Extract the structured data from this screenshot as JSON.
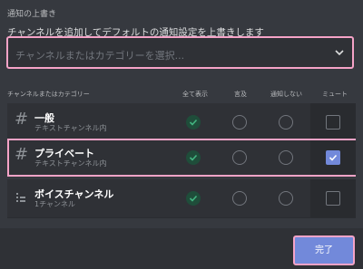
{
  "header": {
    "title": "通知の上書き",
    "description": "チャンネルを追加してデフォルトの通知設定を上書きします"
  },
  "select": {
    "placeholder": "チャンネルまたはカテゴリーを選択..."
  },
  "columns": {
    "channel": "チャンネルまたはカテゴリー",
    "all": "全て表示",
    "mentions": "言及",
    "nothing": "通知しない",
    "mute": "ミュート"
  },
  "rows": [
    {
      "name": "一般",
      "sub": "テキストチャンネル内",
      "icon": "hash-icon",
      "selected": "all",
      "muted": false
    },
    {
      "name": "プライベート",
      "sub": "テキストチャンネル内",
      "icon": "hash-icon",
      "selected": "all",
      "muted": true
    },
    {
      "name": "ボイスチャンネル",
      "sub": "1チャンネル",
      "icon": "voice-category-icon",
      "selected": "all",
      "muted": false
    }
  ],
  "footer": {
    "done_label": "完了"
  },
  "colors": {
    "background": "#36393f",
    "accent": "#7289da",
    "highlight": "#f5a3c7",
    "radio_selected": "#43b581"
  }
}
